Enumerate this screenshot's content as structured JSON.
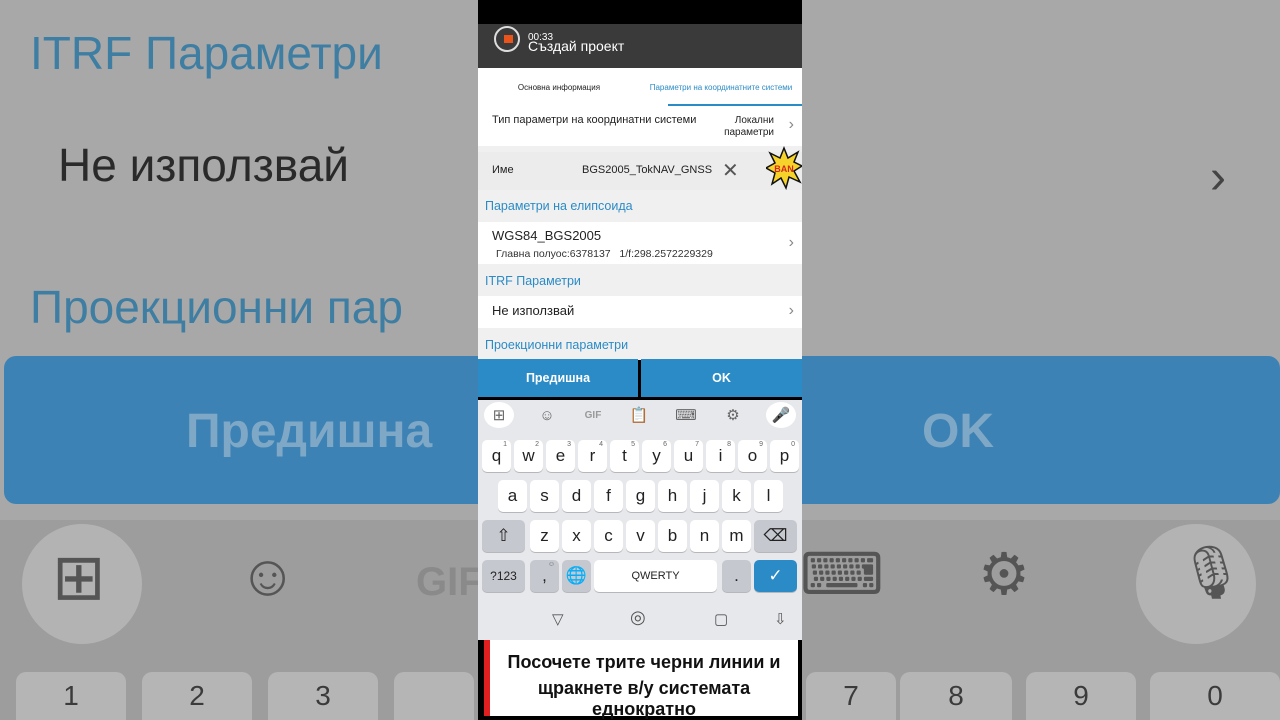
{
  "background": {
    "itrf_title": "ITRF Параметри",
    "do_not_use": "Не използвай",
    "projection_title": "Проекционни пар",
    "previous": "Предишна",
    "ok": "OK",
    "gif": "GIF",
    "digits": [
      "1",
      "2",
      "3",
      "7",
      "8",
      "9",
      "0"
    ]
  },
  "status": {
    "recording_time": "00:33"
  },
  "appbar": {
    "title": "Създай проект"
  },
  "tabs": [
    {
      "label": "Основна информация",
      "selected": false
    },
    {
      "label": "Параметри на координатните системи",
      "selected": true
    }
  ],
  "form": {
    "param_type_label": "Тип параметри на координатни системи",
    "param_type_value": "Локални параметри",
    "name_label": "Име",
    "name_value": "BGS2005_TokNAV_GNSS",
    "ellipsoid_section": "Параметри на елипсоида",
    "ellipsoid_name": "WGS84_BGS2005",
    "semi_major": "Главна полуос:6378137",
    "flattening": "1/f:298.2572229329",
    "itrf_section": "ITRF Параметри",
    "itrf_value": "Не използвай",
    "projection_section": "Проекционни параметри"
  },
  "buttons": {
    "previous": "Предишна",
    "ok": "OK"
  },
  "keyboard": {
    "toolbar": [
      "apps-icon",
      "sticker-icon",
      "GIF",
      "clipboard-icon",
      "keyboard-icon",
      "settings-icon",
      "mic-icon"
    ],
    "row1": [
      {
        "k": "q",
        "s": "1"
      },
      {
        "k": "w",
        "s": "2"
      },
      {
        "k": "e",
        "s": "3"
      },
      {
        "k": "r",
        "s": "4"
      },
      {
        "k": "t",
        "s": "5"
      },
      {
        "k": "y",
        "s": "6"
      },
      {
        "k": "u",
        "s": "7"
      },
      {
        "k": "i",
        "s": "8"
      },
      {
        "k": "o",
        "s": "9"
      },
      {
        "k": "p",
        "s": "0"
      }
    ],
    "row2": [
      "a",
      "s",
      "d",
      "f",
      "g",
      "h",
      "j",
      "k",
      "l"
    ],
    "row3": [
      "z",
      "x",
      "c",
      "v",
      "b",
      "n",
      "m"
    ],
    "symbols_key": "?123",
    "comma_key": ",",
    "space_label": "QWERTY",
    "period_key": "."
  },
  "caption": {
    "line1": "Посочете трите черни линии и",
    "line2": "щракнете в/у системата еднократно"
  },
  "colors": {
    "accent": "#2b8bc6",
    "appbar": "#3a3a3a",
    "caption_border": "#e02020"
  }
}
